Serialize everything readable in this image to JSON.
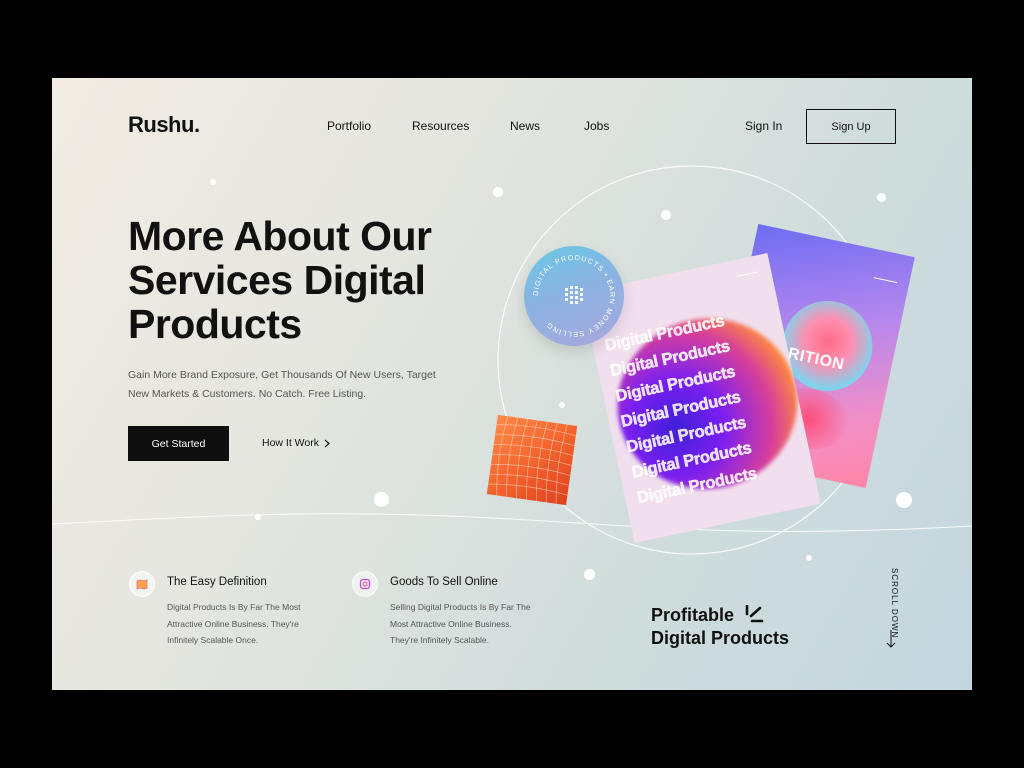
{
  "brand": {
    "logo": "Rushu."
  },
  "nav": {
    "items": [
      "Portfolio",
      "Resources",
      "News",
      "Jobs"
    ],
    "sign_in": "Sign In",
    "sign_up": "Sign Up"
  },
  "hero": {
    "headline_lines": [
      "More About Our",
      "Services Digital",
      "Products"
    ],
    "subtitle_lines": [
      "Gain More Brand Exposure, Get Thousands Of New Users, Target",
      "New Markets & Customers. No Catch. Free Listing."
    ],
    "primary_cta": "Get Started",
    "secondary_cta": "How It Work"
  },
  "features": [
    {
      "icon": "map-icon",
      "title": "The Easy Definition",
      "desc_lines": [
        "Digital Products Is By Far The Most",
        "Attractive Online Business. They're",
        "Infinitely Scalable Once."
      ]
    },
    {
      "icon": "instagram-icon",
      "title": "Goods To Sell Online",
      "desc_lines": [
        "Selling Digital Products Is By Far The",
        "Most Attractive Online Business.",
        "They're Infinitely Scalable."
      ]
    }
  ],
  "profitable": {
    "lines": [
      "Profitable",
      "Digital Products"
    ]
  },
  "scroll": {
    "label": "SCROLL DOWN"
  },
  "artwork": {
    "badge_text": "DIGITAL PRODUCTS • EARN MONEY SELLING",
    "card_repeat_text": "Digital Products",
    "back_card_text": "RITION"
  },
  "colors": {
    "dark": "#0e0e0e",
    "accent_orange": "#f2612b",
    "accent_purple": "#7b1ff0"
  }
}
